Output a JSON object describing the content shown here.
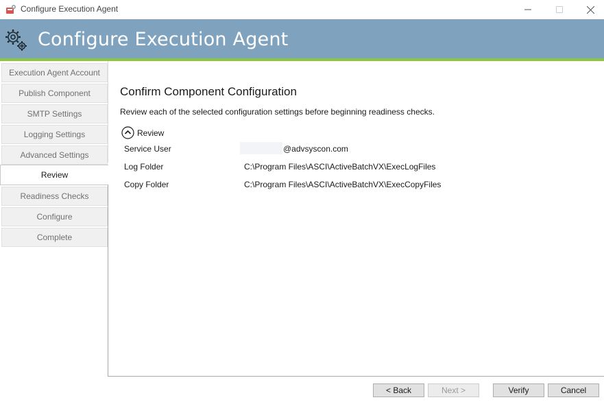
{
  "window": {
    "title": "Configure Execution Agent"
  },
  "banner": {
    "title": "Configure Execution Agent"
  },
  "sidebar": {
    "items": [
      {
        "label": "Execution Agent Account",
        "active": false
      },
      {
        "label": "Publish Component",
        "active": false
      },
      {
        "label": "SMTP Settings",
        "active": false
      },
      {
        "label": "Logging Settings",
        "active": false
      },
      {
        "label": "Advanced Settings",
        "active": false
      },
      {
        "label": "Review",
        "active": true
      },
      {
        "label": "Readiness Checks",
        "active": false
      },
      {
        "label": "Configure",
        "active": false
      },
      {
        "label": "Complete",
        "active": false
      }
    ]
  },
  "main": {
    "heading": "Confirm Component Configuration",
    "description": "Review each of the selected configuration settings before beginning readiness checks.",
    "section_label": "Review",
    "rows": [
      {
        "label": "Service User",
        "value": "@advsyscon.com"
      },
      {
        "label": "Log Folder",
        "value": "C:\\Program Files\\ASCI\\ActiveBatchVX\\ExecLogFiles"
      },
      {
        "label": "Copy Folder",
        "value": "C:\\Program Files\\ASCI\\ActiveBatchVX\\ExecCopyFiles"
      }
    ]
  },
  "buttons": {
    "back": "< Back",
    "next": "Next >",
    "verify": "Verify",
    "cancel": "Cancel"
  },
  "colors": {
    "banner": "#7fa3bf",
    "accent": "#8cc63f"
  }
}
